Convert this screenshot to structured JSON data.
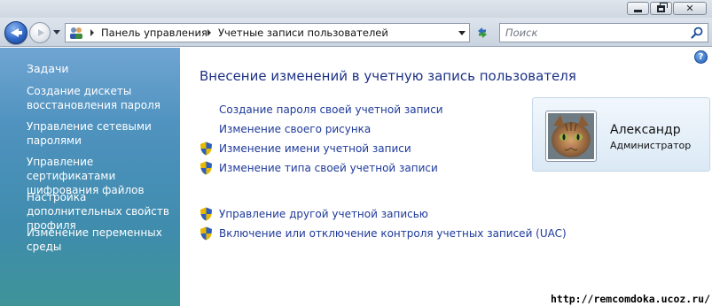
{
  "window": {
    "buttons": [
      "minimize",
      "maximize",
      "close"
    ]
  },
  "address_bar": {
    "crumbs": [
      "Панель управления",
      "Учетные записи пользователей"
    ]
  },
  "search": {
    "placeholder": "Поиск"
  },
  "sidebar": {
    "title": "Задачи",
    "items": [
      {
        "label": "Создание дискеты восстановления пароля"
      },
      {
        "label": "Управление сетевыми паролями"
      },
      {
        "label": "Управление сертификатами шифрования файлов"
      },
      {
        "label": "Настройка дополнительных свойств профиля"
      },
      {
        "label": "Изменение переменных среды"
      }
    ]
  },
  "main": {
    "help_label": "?",
    "title": "Внесение изменений в учетную запись пользователя",
    "actions": [
      {
        "label": "Создание пароля своей учетной записи",
        "shield": false
      },
      {
        "label": "Изменение своего рисунка",
        "shield": false
      },
      {
        "label": "Изменение имени учетной записи",
        "shield": true
      },
      {
        "label": "Изменение типа своей учетной записи",
        "shield": true
      },
      {
        "label": "Управление другой учетной записью",
        "shield": true
      },
      {
        "label": "Включение или отключение контроля учетных записей (UAC)",
        "shield": true
      }
    ]
  },
  "user": {
    "name": "Александр",
    "role": "Администратор"
  },
  "watermark": "http://remcomdoka.ucoz.ru/",
  "colors": {
    "link": "#1e3a9a",
    "title": "#1e3287",
    "sidebar_top": "#70a5d2",
    "sidebar_bottom": "#3e9498",
    "user_tile": "#dbe9f5"
  }
}
